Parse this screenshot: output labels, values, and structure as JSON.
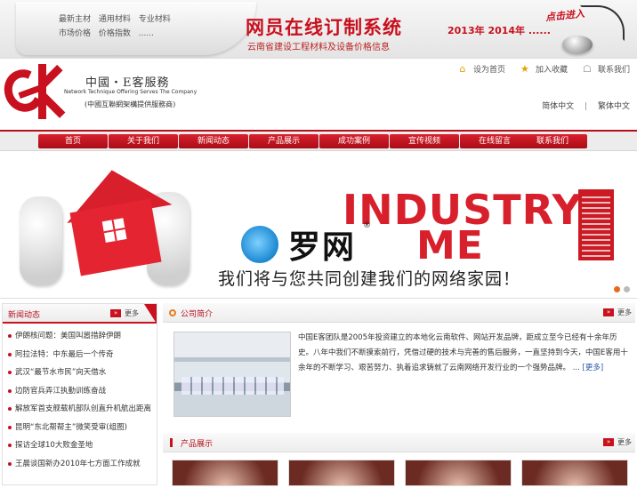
{
  "banner": {
    "links": [
      "最新主材",
      "通用材料",
      "专业材料",
      "市场价格",
      "价格指数",
      "......"
    ],
    "title": "网员在线订制系统",
    "subtitle": "云南省建设工程材料及设备价格信息",
    "years": "2013年  2014年 ......",
    "enter": "点击进入"
  },
  "brand": {
    "name": "中國・E客服務",
    "english": "Network Technique Offering Serves The Company",
    "note": "(中國互聯網架構提供服務商)"
  },
  "header_links": {
    "home": "设为首页",
    "favorite": "加入收藏",
    "contact": "联系我们",
    "lang_simplified": "简体中文",
    "lang_separator": "|",
    "lang_traditional": "繁体中文"
  },
  "nav": [
    "首页",
    "关于我们",
    "新闻动态",
    "产品展示",
    "成功案例",
    "宣传视频",
    "在线留言",
    "联系我们"
  ],
  "hero": {
    "word1": "INDUSTRY",
    "word2": "ME",
    "slogan": "我们将与您共同创建我们的网络家园！",
    "watermark": "罗网",
    "watermark_reg": "®"
  },
  "news": {
    "title": "新闻动态",
    "more": "更多",
    "items": [
      "伊朗核问题：美国叫嚣措辞伊朗",
      "阿拉法特：中东最后一个传奇",
      "武汉“最节水市民”向天借水",
      "边防官兵弄江执勤训练奋战",
      "解放军首支舰载机部队创直升机航出距离",
      "昆明“东北帮帮主”微笑受审(组图)",
      "探访全球10大败金圣地",
      "王晨谈国新办2010年七方面工作成就"
    ]
  },
  "intro": {
    "title": "公司简介",
    "more": "更多",
    "text": "中国E客团队是2005年投资建立的本地化云南软件、网站开发品牌，距成立至今已经有十余年历史。八年中我们不断摸索前行，凭借过硬的技术与完善的售后服务，一直坚持到今天，中国E客用十余年的不断学习、艰苦努力、执着追求铸就了云南网络开发行业的一个强势品牌。",
    "ellipsis": "...",
    "more_link": "[更多]"
  },
  "products": {
    "title": "产品展示",
    "more": "更多"
  }
}
